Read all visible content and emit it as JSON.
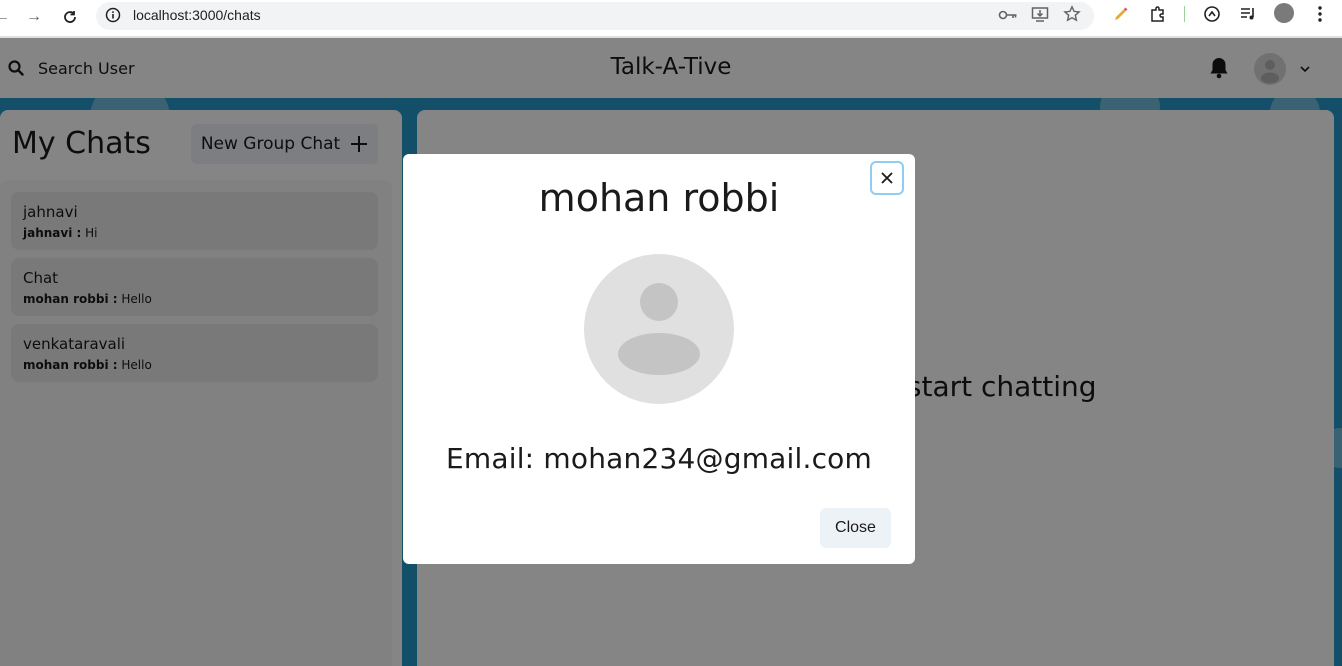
{
  "browser": {
    "url": "localhost:3000/chats",
    "icons": [
      "back-icon",
      "forward-icon",
      "reload-icon",
      "site-info-icon",
      "key-icon",
      "install-icon",
      "star-icon",
      "pen-icon",
      "extensions-icon",
      "spiral-icon",
      "media-icon",
      "profile-icon",
      "menu-icon"
    ]
  },
  "header": {
    "search_label": "Search User",
    "app_title": "Talk-A-Tive"
  },
  "sidebar": {
    "title": "My Chats",
    "new_group_label": "New Group Chat",
    "chats": [
      {
        "name": "jahnavi",
        "sender": "jahnavi :",
        "message": "Hi"
      },
      {
        "name": "Chat",
        "sender": "mohan robbi :",
        "message": "Hello"
      },
      {
        "name": "venkataravali",
        "sender": "mohan robbi :",
        "message": "Hello"
      }
    ]
  },
  "main": {
    "placeholder": "Click on a user to start chatting"
  },
  "modal": {
    "title": "mohan robbi",
    "email": "Email: mohan234@gmail.com",
    "close_label": "Close"
  },
  "colors": {
    "background_blue": "#2598c9",
    "button_gray": "#edf2f7",
    "overlay": "rgba(0,0,0,0.48)",
    "focus_ring": "#90cdf4"
  }
}
